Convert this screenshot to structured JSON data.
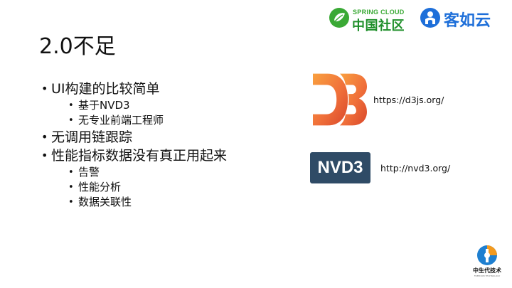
{
  "logos": {
    "spring_cloud_top": "SPRING CLOUD",
    "spring_cloud_bottom": "中国社区",
    "keruyun": "客如云"
  },
  "slide": {
    "title": "2.0不足",
    "bullets": [
      {
        "text": "UI构建的比较简单",
        "sub": [
          "基于NVD3",
          "无专业前端工程师"
        ]
      },
      {
        "text": "无调用链跟踪",
        "sub": []
      },
      {
        "text": "性能指标数据没有真正用起来",
        "sub": [
          "告警",
          "性能分析",
          "数据关联性"
        ]
      }
    ]
  },
  "d3": {
    "url": "https://d3js.org/"
  },
  "nvd3": {
    "label": "NVD3",
    "url": "http://nvd3.org/"
  },
  "brand": {
    "name": "中生代技术",
    "sub": "FREEDOM TECHNOLOGY"
  },
  "colors": {
    "spring_green": "#3aa935",
    "keruyun_blue": "#1e6fd9",
    "d3_orange": "#f68e3e",
    "d3_red": "#e04e2f",
    "nvd3_bg": "#2f4b66"
  }
}
